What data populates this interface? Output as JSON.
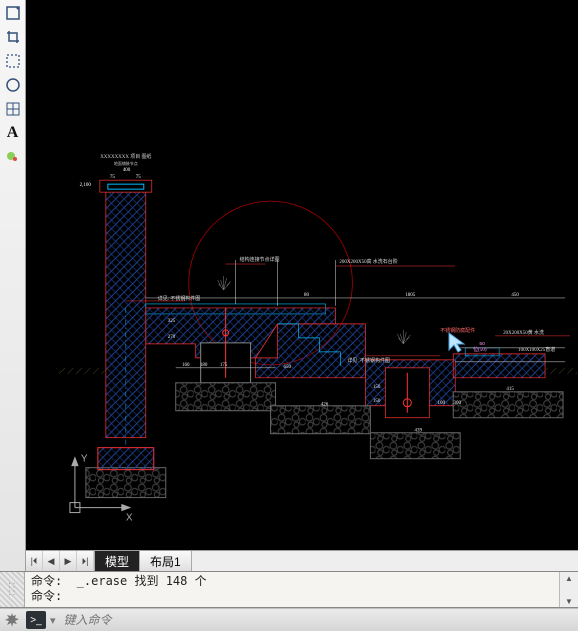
{
  "toolbox": {
    "items": [
      {
        "name": "rect-select-icon",
        "glyph": "rect-dot"
      },
      {
        "name": "crop-icon",
        "glyph": "crop"
      },
      {
        "name": "marquee-icon",
        "glyph": "marquee"
      },
      {
        "name": "circle-select-icon",
        "glyph": "circle"
      },
      {
        "name": "grid-icon",
        "glyph": "grid"
      },
      {
        "name": "text-tool",
        "glyph": "A"
      },
      {
        "name": "color-tool",
        "glyph": "color-dot"
      }
    ]
  },
  "tabs": {
    "model": "模型",
    "layout1": "布局1"
  },
  "command": {
    "history_line1": "命令:  _.erase 找到 148 个",
    "history_line2": "命令:",
    "input_placeholder": "键入命令"
  },
  "drawing": {
    "title_block": "XXXXXXXX 项目 图纸",
    "sub_block": "地面铺装节点",
    "dims": {
      "d2100": "2,100",
      "d75a": "75",
      "d75b": "75",
      "d80": "80",
      "d400": "400",
      "d160": "160",
      "d180": "180",
      "d175": "175",
      "d650": "650",
      "d270": "270",
      "d325": "325",
      "d426": "426",
      "d439": "439",
      "d150a": "150",
      "d150b": "150",
      "d415": "415",
      "d300": "300",
      "d50": "50",
      "d1805": "1805",
      "d450": "450",
      "d100": "100"
    },
    "labels": {
      "l_top": "结构连接节点详图",
      "l_right_a": "200X200X50高 水洗石台阶",
      "l_right_b": "不锈钢防腐配件",
      "l_center": "详见: 不锈钢构件图",
      "l_mid": "详见: 不锈钢构件图",
      "l_flow": "20X200X50黄 水洗",
      "l_lower_right": "100X100X25盲道",
      "l_pos": "位(50)"
    },
    "ucs": {
      "y": "Y",
      "x": "X"
    }
  }
}
